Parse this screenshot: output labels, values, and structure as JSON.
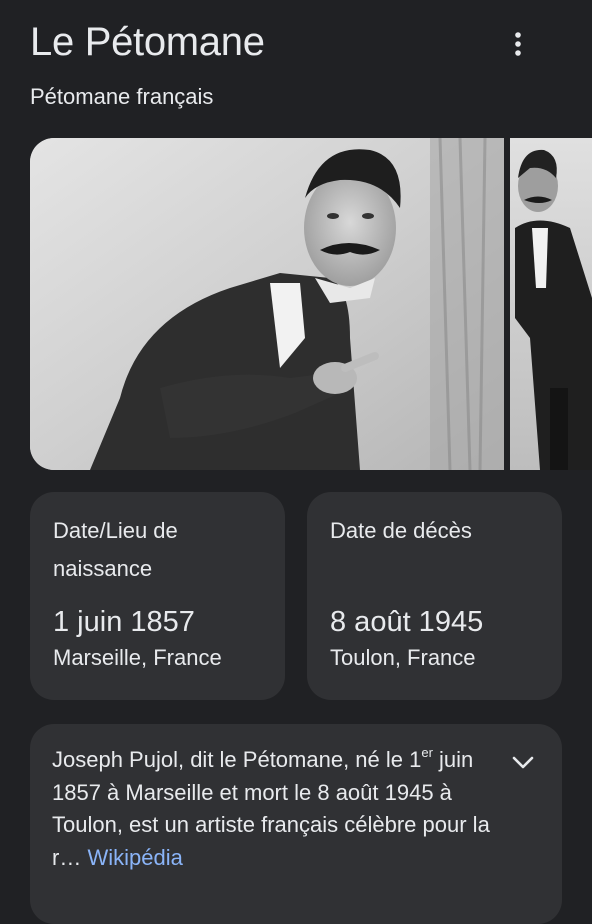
{
  "header": {
    "title": "Le Pétomane",
    "subtitle": "Pétomane français",
    "menu_icon": "more-vert-icon"
  },
  "images": [
    {
      "name": "main-photo",
      "kind": "black-and-white portrait"
    },
    {
      "name": "second-photo",
      "kind": "black-and-white portrait"
    }
  ],
  "facts": {
    "birth": {
      "label": "Date/Lieu de naissance",
      "date": "1 juin 1857",
      "place": "Marseille, France"
    },
    "death": {
      "label": "Date de décès",
      "date": "8 août 1945",
      "place": "Toulon, France"
    }
  },
  "description": {
    "part1": "Joseph Pujol, dit le Pétomane, né le 1",
    "sup": "er",
    "part2": " juin 1857 à Marseille et mort le 8 août 1945 à Toulon, est un artiste français célèbre pour la r… ",
    "source_link": "Wikipédia",
    "expand_icon": "chevron-down-icon"
  },
  "colors": {
    "background": "#202124",
    "card": "#303134",
    "text": "#e8eaed",
    "link": "#8ab4f8"
  }
}
